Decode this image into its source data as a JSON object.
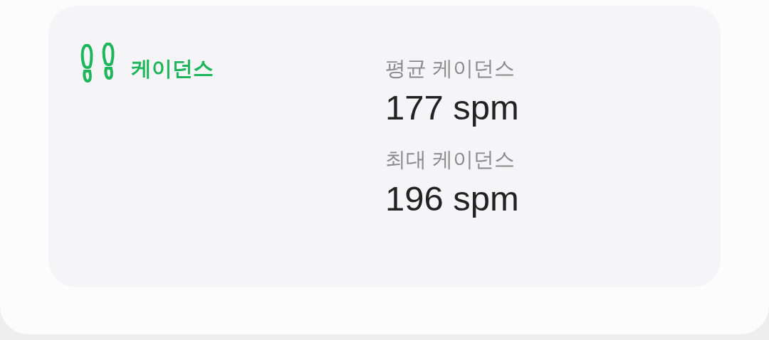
{
  "section": {
    "title": "케이던스"
  },
  "stats": [
    {
      "label": "평균 케이던스",
      "value": "177 spm"
    },
    {
      "label": "최대 케이던스",
      "value": "196 spm"
    }
  ]
}
